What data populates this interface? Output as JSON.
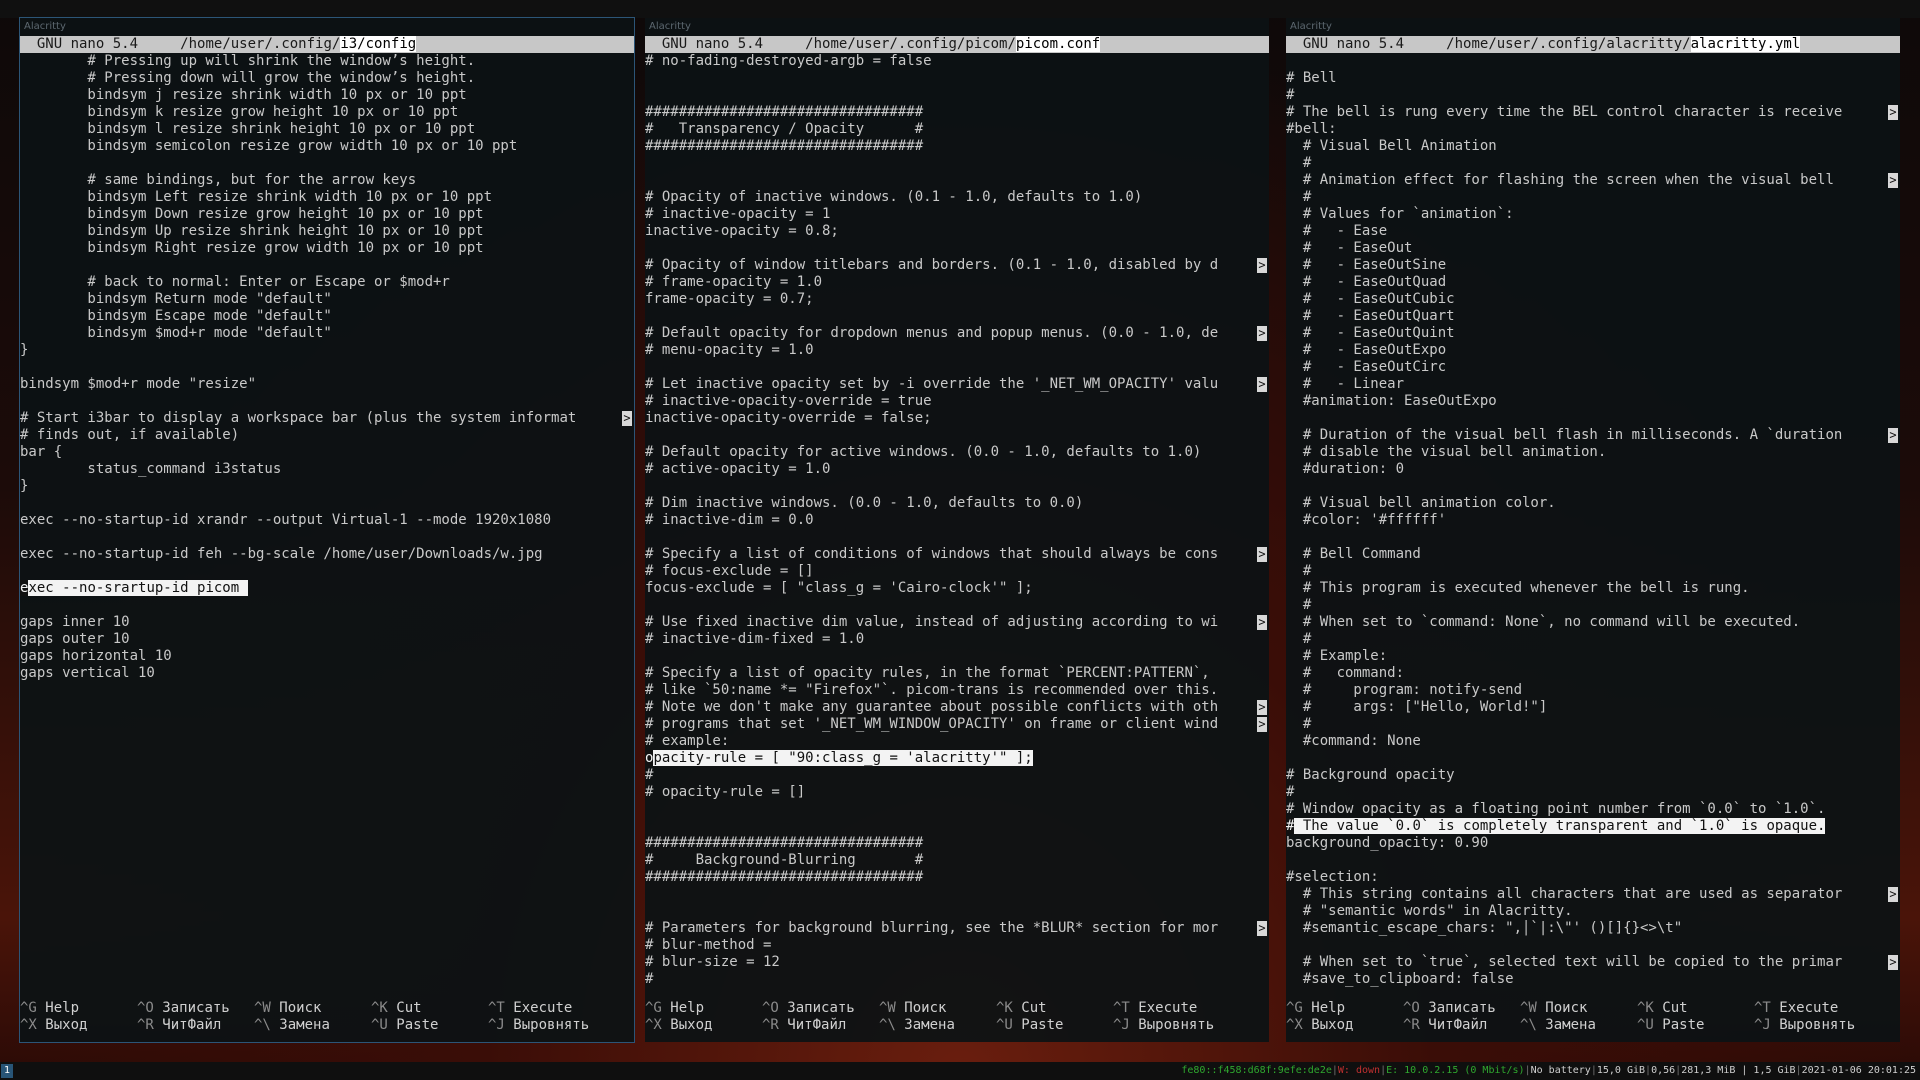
{
  "screen": {
    "workspace": "1"
  },
  "windows": [
    {
      "window_title": "Alacritty",
      "nano_version": "GNU nano 5.4",
      "path_prefix": "/home/user/.config/",
      "file_name": "i3/config",
      "cursor_line": 31,
      "lines": [
        "        # Pressing up will shrink the window’s height.",
        "        # Pressing down will grow the window’s height.",
        "        bindsym j resize shrink width 10 px or 10 ppt",
        "        bindsym k resize grow height 10 px or 10 ppt",
        "        bindsym l resize shrink height 10 px or 10 ppt",
        "        bindsym semicolon resize grow width 10 px or 10 ppt",
        "",
        "        # same bindings, but for the arrow keys",
        "        bindsym Left resize shrink width 10 px or 10 ppt",
        "        bindsym Down resize grow height 10 px or 10 ppt",
        "        bindsym Up resize shrink height 10 px or 10 ppt",
        "        bindsym Right resize grow width 10 px or 10 ppt",
        "",
        "        # back to normal: Enter or Escape or $mod+r",
        "        bindsym Return mode \"default\"",
        "        bindsym Escape mode \"default\"",
        "        bindsym $mod+r mode \"default\"",
        "}",
        "",
        "bindsym $mod+r mode \"resize\"",
        "",
        "# Start i3bar to display a workspace bar (plus the system informat",
        "# finds out, if available)",
        "bar {",
        "        status_command i3status",
        "}",
        "",
        "exec --no-startup-id xrandr --output Virtual-1 --mode 1920x1080",
        "",
        "exec --no-startup-id feh --bg-scale /home/user/Downloads/w.jpg",
        "",
        "exec --no-srartup-id picom ",
        "",
        "gaps inner 10",
        "gaps outer 10",
        "gaps horizontal 10",
        "gaps vertical 10"
      ],
      "overflow_lines": [
        21
      ]
    },
    {
      "window_title": "Alacritty",
      "nano_version": "GNU nano 5.4",
      "path_prefix": "/home/user/.config/picom/",
      "file_name": "picom.conf",
      "cursor_line": 41,
      "lines": [
        "# no-fading-destroyed-argb = false",
        "",
        "",
        "#################################",
        "#   Transparency / Opacity      #",
        "#################################",
        "",
        "",
        "# Opacity of inactive windows. (0.1 - 1.0, defaults to 1.0)",
        "# inactive-opacity = 1",
        "inactive-opacity = 0.8;",
        "",
        "# Opacity of window titlebars and borders. (0.1 - 1.0, disabled by d",
        "# frame-opacity = 1.0",
        "frame-opacity = 0.7;",
        "",
        "# Default opacity for dropdown menus and popup menus. (0.0 - 1.0, de",
        "# menu-opacity = 1.0",
        "",
        "# Let inactive opacity set by -i override the '_NET_WM_OPACITY' valu",
        "# inactive-opacity-override = true",
        "inactive-opacity-override = false;",
        "",
        "# Default opacity for active windows. (0.0 - 1.0, defaults to 1.0)",
        "# active-opacity = 1.0",
        "",
        "# Dim inactive windows. (0.0 - 1.0, defaults to 0.0)",
        "# inactive-dim = 0.0",
        "",
        "# Specify a list of conditions of windows that should always be cons",
        "# focus-exclude = []",
        "focus-exclude = [ \"class_g = 'Cairo-clock'\" ];",
        "",
        "# Use fixed inactive dim value, instead of adjusting according to wi",
        "# inactive-dim-fixed = 1.0",
        "",
        "# Specify a list of opacity rules, in the format `PERCENT:PATTERN`,",
        "# like `50:name *= \"Firefox\"`. picom-trans is recommended over this.",
        "# Note we don't make any guarantee about possible conflicts with oth",
        "# programs that set '_NET_WM_WINDOW_OPACITY' on frame or client wind",
        "# example:",
        "opacity-rule = [ \"90:class_g = 'alacritty'\" ];",
        "#",
        "# opacity-rule = []",
        "",
        "",
        "#################################",
        "#     Background-Blurring       #",
        "#################################",
        "",
        "",
        "# Parameters for background blurring, see the *BLUR* section for mor",
        "# blur-method =",
        "# blur-size = 12",
        "#"
      ],
      "overflow_lines": [
        12,
        16,
        19,
        29,
        33,
        38,
        39,
        51
      ]
    },
    {
      "window_title": "Alacritty",
      "nano_version": "GNU nano 5.4",
      "path_prefix": "/home/user/.config/alacritty/",
      "file_name": "alacritty.yml",
      "cursor_line": 45,
      "lines": [
        "",
        "# Bell",
        "#",
        "# The bell is rung every time the BEL control character is receive",
        "#bell:",
        "  # Visual Bell Animation",
        "  #",
        "  # Animation effect for flashing the screen when the visual bell ",
        "  #",
        "  # Values for `animation`:",
        "  #   - Ease",
        "  #   - EaseOut",
        "  #   - EaseOutSine",
        "  #   - EaseOutQuad",
        "  #   - EaseOutCubic",
        "  #   - EaseOutQuart",
        "  #   - EaseOutQuint",
        "  #   - EaseOutExpo",
        "  #   - EaseOutCirc",
        "  #   - Linear",
        "  #animation: EaseOutExpo",
        "",
        "  # Duration of the visual bell flash in milliseconds. A `duration",
        "  # disable the visual bell animation.",
        "  #duration: 0",
        "",
        "  # Visual bell animation color.",
        "  #color: '#ffffff'",
        "",
        "  # Bell Command",
        "  #",
        "  # This program is executed whenever the bell is rung.",
        "  #",
        "  # When set to `command: None`, no command will be executed.",
        "  #",
        "  # Example:",
        "  #   command:",
        "  #     program: notify-send",
        "  #     args: [\"Hello, World!\"]",
        "  #",
        "  #command: None",
        "",
        "# Background opacity",
        "#",
        "# Window opacity as a floating point number from `0.0` to `1.0`.",
        "# The value `0.0` is completely transparent and `1.0` is opaque.",
        "background_opacity: 0.90 ",
        "",
        "#selection:",
        "  # This string contains all characters that are used as separator",
        "  # \"semantic words\" in Alacritty.",
        "  #semantic_escape_chars: \",│`|:\\\"' ()[]{}<>\\t\"",
        "",
        "  # When set to `true`, selected text will be copied to the primar",
        "  #save_to_clipboard: false"
      ],
      "overflow_lines": [
        3,
        7,
        22,
        49,
        53
      ]
    }
  ],
  "help_shortcuts": [
    [
      {
        "key": "^G",
        "label": "Help"
      },
      {
        "key": "^O",
        "label": "Записать"
      },
      {
        "key": "^W",
        "label": "Поиск"
      },
      {
        "key": "^K",
        "label": "Cut"
      },
      {
        "key": "^T",
        "label": "Execute"
      }
    ],
    [
      {
        "key": "^X",
        "label": "Выход"
      },
      {
        "key": "^R",
        "label": "ЧитФайл"
      },
      {
        "key": "^\\",
        "label": "Замена"
      },
      {
        "key": "^U",
        "label": "Paste"
      },
      {
        "key": "^J",
        "label": "Выровнять"
      }
    ]
  ],
  "overflow_marker": ">",
  "status": {
    "ipv6": "fe80::f458:d68f:9efe:de2e",
    "wifi": "W: down",
    "ethernet": "E: 10.0.2.15 (0 Mbit/s)",
    "battery": "No battery",
    "disk": "15,0 GiB",
    "load": "0,56",
    "memory": "281,3 MiB | 1,5 GiB",
    "datetime": "2021-01-06 20:01:25",
    "separator": "|"
  },
  "colors": {
    "focus_border": "#2c5577",
    "workspace_bg": "#285577",
    "status_good": "#2fa82f",
    "status_bad": "#c03030"
  }
}
